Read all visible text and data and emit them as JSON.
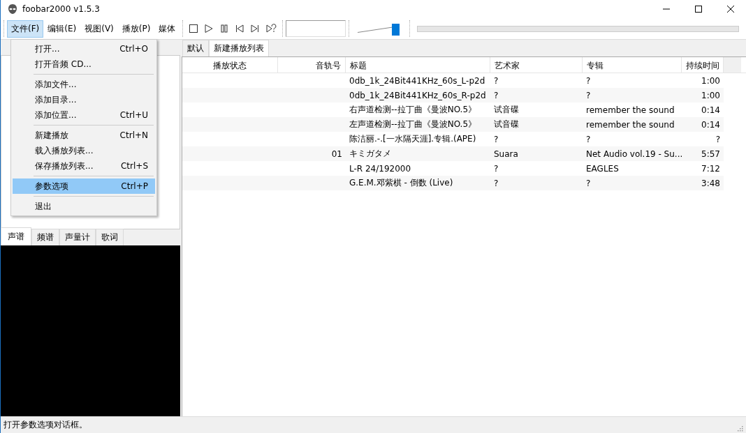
{
  "window": {
    "title": "foobar2000 v1.5.3"
  },
  "menu_bar": [
    {
      "label": "文件(F)",
      "selected": true
    },
    {
      "label": "编辑(E)",
      "selected": false
    },
    {
      "label": "视图(V)",
      "selected": false
    },
    {
      "label": "播放(P)",
      "selected": false
    },
    {
      "label": "媒体",
      "selected": false
    }
  ],
  "volume": {
    "level": 0.9
  },
  "file_menu": [
    {
      "kind": "command",
      "label": "打开...",
      "shortcut": "Ctrl+O",
      "selected": false
    },
    {
      "kind": "command",
      "label": "打开音频 CD...",
      "selected": false
    },
    {
      "kind": "separator"
    },
    {
      "kind": "command",
      "label": "添加文件...",
      "selected": false
    },
    {
      "kind": "command",
      "label": "添加目录...",
      "selected": false
    },
    {
      "kind": "command",
      "label": "添加位置...",
      "shortcut": "Ctrl+U",
      "selected": false
    },
    {
      "kind": "separator"
    },
    {
      "kind": "command",
      "label": "新建播放",
      "shortcut": "Ctrl+N",
      "selected": false
    },
    {
      "kind": "command",
      "label": "载入播放列表...",
      "selected": false
    },
    {
      "kind": "command",
      "label": "保存播放列表...",
      "shortcut": "Ctrl+S",
      "selected": false
    },
    {
      "kind": "separator"
    },
    {
      "kind": "command",
      "label": "参数选项",
      "shortcut": "Ctrl+P",
      "selected": true
    },
    {
      "kind": "separator"
    },
    {
      "kind": "command",
      "label": "退出",
      "selected": false
    }
  ],
  "visual_tabs": [
    {
      "label": "声谱",
      "selected": true
    },
    {
      "label": "频谱",
      "selected": false
    },
    {
      "label": "声量计",
      "selected": false
    },
    {
      "label": "歌词",
      "selected": false
    }
  ],
  "playlist_tabs": [
    {
      "label": "默认",
      "selected": false
    },
    {
      "label": "新建播放列表",
      "selected": true
    }
  ],
  "table": {
    "columns": [
      "播放状态",
      "音轨号",
      "标题",
      "艺术家",
      "专辑",
      "持续时间"
    ],
    "rows": [
      [
        "",
        "",
        "0db_1k_24Bit441KHz_60s_L-p2d",
        "?",
        "?",
        "1:00"
      ],
      [
        "",
        "",
        "0db_1k_24Bit441KHz_60s_R-p2d",
        "?",
        "?",
        "1:00"
      ],
      [
        "",
        "",
        "右声道检测--拉丁曲《曼波NO.5》",
        "试音碟",
        "remember the sound",
        "0:14"
      ],
      [
        "",
        "",
        "左声道检测--拉丁曲《曼波NO.5》",
        "试音碟",
        "remember the sound",
        "0:14"
      ],
      [
        "",
        "",
        "陈洁丽.-.[一水隔天涯].专辑.(APE)",
        "?",
        "?",
        "?"
      ],
      [
        "",
        "01",
        "キミガタメ",
        "Suara",
        "Net Audio vol.19 - Su...",
        "5:57"
      ],
      [
        "",
        "",
        "L-R 24/192000",
        "?",
        "EAGLES",
        "7:12"
      ],
      [
        "",
        "",
        "G.E.M.邓紫棋 - 倒数 (Live)",
        "?",
        "?",
        "3:48"
      ]
    ]
  },
  "status_bar": {
    "text": "打开参数选项对话框。"
  }
}
